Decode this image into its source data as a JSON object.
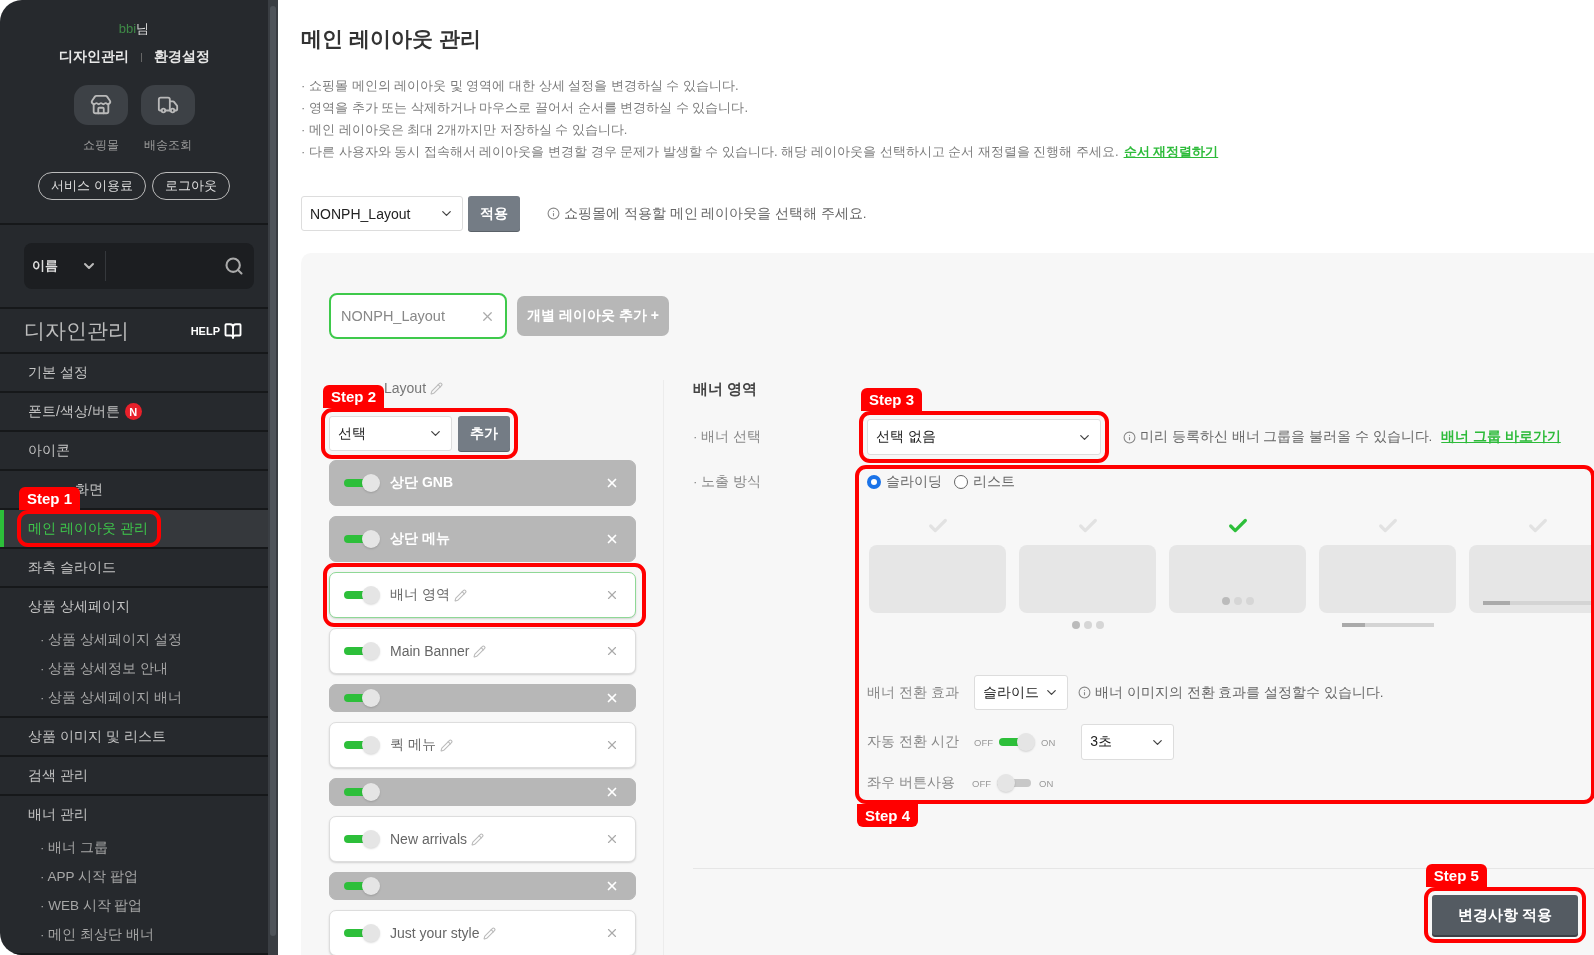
{
  "sidebar": {
    "user": {
      "name": "bbi",
      "suffix": "님"
    },
    "top_links": [
      "디자인관리",
      "환경설정"
    ],
    "shortcuts": [
      {
        "kind": "store",
        "label": "쇼핑몰"
      },
      {
        "kind": "truck",
        "label": "배송조회"
      }
    ],
    "pill_buttons": [
      "서비스 이용료",
      "로그아웃"
    ],
    "search": {
      "filter": "이름"
    },
    "section_title": "디자인관리",
    "help": "HELP",
    "menu": [
      {
        "label": "기본 설정",
        "selected": false
      },
      {
        "label": "폰트/색상/버튼",
        "selected": false,
        "badge": "N"
      },
      {
        "label": "아이콘",
        "selected": false
      },
      {
        "label": "화면",
        "selected": false,
        "obscured": true
      },
      {
        "label": "메인 레이아웃 관리",
        "selected": true,
        "step": "Step 1"
      },
      {
        "label": "좌측 슬라이드",
        "selected": false
      },
      {
        "label": "상품 상세페이지",
        "selected": false,
        "children": [
          {
            "label": "· 상품 상세페이지 설정",
            "selected": false
          },
          {
            "label": "· 상품 상세정보 안내",
            "selected": false
          },
          {
            "label": "· 상품 상세페이지 배너",
            "selected": false
          }
        ]
      },
      {
        "label": "상품 이미지 및 리스트",
        "selected": false
      },
      {
        "label": "검색 관리",
        "selected": false
      },
      {
        "label": "배너 관리",
        "selected": false,
        "children": [
          {
            "label": "· 배너 그룹",
            "selected": false
          },
          {
            "label": "· APP 시작 팝업",
            "selected": false
          },
          {
            "label": "· WEB 시작 팝업",
            "selected": false
          },
          {
            "label": "· 메인 최상단 배너",
            "selected": false
          }
        ]
      }
    ]
  },
  "page": {
    "title": "메인 레이아웃 관리",
    "notes": [
      {
        "text": "· 쇼핑몰 메인의 레이아웃 및 영역에 대한 상세 설정을 변경하실 수 있습니다."
      },
      {
        "text": "· 영역을 추가 또는 삭제하거나 마우스로 끌어서 순서를 변경하실 수 있습니다."
      },
      {
        "text": "· 메인 레이아웃은 최대 2개까지만 저장하실 수 있습니다."
      },
      {
        "text": "· 다른 사용자와 동시 접속해서 레이아웃을 변경할 경우 문제가 발생할 수 있습니다. 해당 레이아웃을 선택하시고 순서 재정렬을 진행해 주세요.",
        "link": "순서 재정렬하기"
      }
    ],
    "layout_select": {
      "value": "NONPH_Layout",
      "button": "적용",
      "hint": "쇼핑몰에 적용할 메인 레이아웃을 선택해 주세요."
    }
  },
  "editor": {
    "tabs": [
      {
        "label": "NONPH_Layout",
        "selected": true
      }
    ],
    "add_tab_button": "개별 레이아웃 추가 +",
    "layout_name": "Layout",
    "area_select": {
      "value": "선택",
      "button": "추가",
      "step": "Step 2"
    },
    "areas": [
      {
        "kind": "fixed",
        "name": "상단 GNB",
        "on": true,
        "selected": false
      },
      {
        "kind": "fixed",
        "name": "상단 메뉴",
        "on": true,
        "selected": false
      },
      {
        "kind": "editable",
        "name": "배너 영역",
        "on": true,
        "selected": true
      },
      {
        "kind": "editable",
        "name": "Main Banner",
        "on": true,
        "selected": false
      },
      {
        "kind": "blank",
        "on": true,
        "selected": false
      },
      {
        "kind": "editable",
        "name": "퀵 메뉴",
        "on": true,
        "selected": false
      },
      {
        "kind": "blank",
        "on": true,
        "selected": false
      },
      {
        "kind": "editable",
        "name": "New arrivals",
        "on": true,
        "selected": false
      },
      {
        "kind": "blank",
        "on": true,
        "selected": false
      },
      {
        "kind": "editable",
        "name": "Just your style",
        "on": true,
        "selected": false
      }
    ]
  },
  "settings": {
    "title": "배너 영역",
    "banner_select": {
      "label": "· 배너 선택",
      "value": "선택 없음",
      "hint": "미리 등록하신 배너 그룹을 불러올 수 있습니다.",
      "link": "배너 그룹 바로가기",
      "step": "Step 3"
    },
    "display": {
      "label": "· 노출 방식",
      "step": "Step 4",
      "options": [
        {
          "label": "슬라이딩",
          "selected": true
        },
        {
          "label": "리스트",
          "selected": false
        }
      ],
      "styles": [
        {
          "kind": "plain",
          "selected": false
        },
        {
          "kind": "dotsbelow",
          "selected": false
        },
        {
          "kind": "dotsinside",
          "selected": true
        },
        {
          "kind": "barbelow",
          "selected": false,
          "level": 0.25
        },
        {
          "kind": "barinside",
          "selected": false,
          "level": 0.25
        }
      ],
      "effect": {
        "label": "배너 전환 효과",
        "value": "슬라이드",
        "hint": "배너 이미지의 전환 효과를 설정할수 있습니다."
      },
      "auto": {
        "label": "자동 전환 시간",
        "off_label": "OFF",
        "on_label": "ON",
        "on": true,
        "value": "3초"
      },
      "arrows": {
        "label": "좌우 버튼사용",
        "off_label": "OFF",
        "on_label": "ON",
        "on": false
      }
    },
    "apply_button": {
      "label": "변경사항 적용",
      "step": "Step 5"
    }
  }
}
